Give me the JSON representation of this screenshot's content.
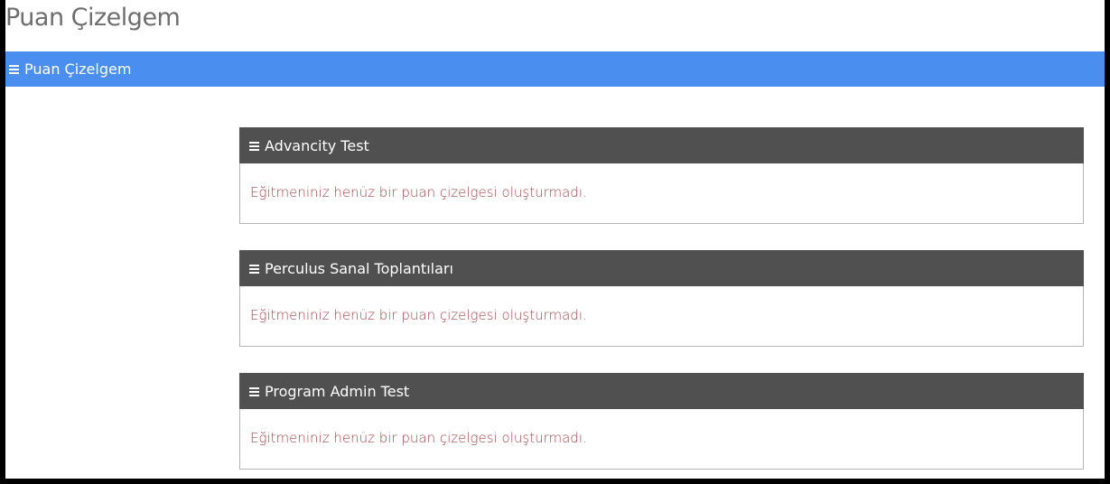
{
  "page": {
    "title": "Puan Çizelgem"
  },
  "section_bar": {
    "label": "Puan Çizelgem",
    "icon": "menu-icon"
  },
  "panels": [
    {
      "title": "Advancity Test",
      "message": "Eğitmeniniz henüz bir puan çizelgesi oluşturmadı."
    },
    {
      "title": "Perculus Sanal Toplantıları",
      "message": "Eğitmeniniz henüz bir puan çizelgesi oluşturmadı."
    },
    {
      "title": "Program Admin Test",
      "message": "Eğitmeniniz henüz bir puan çizelgesi oluşturmadı."
    }
  ],
  "colors": {
    "section_bar": "#4a8ef0",
    "panel_header": "#505050",
    "message_text": "#a9444a",
    "title_text": "#6e6e6e"
  }
}
